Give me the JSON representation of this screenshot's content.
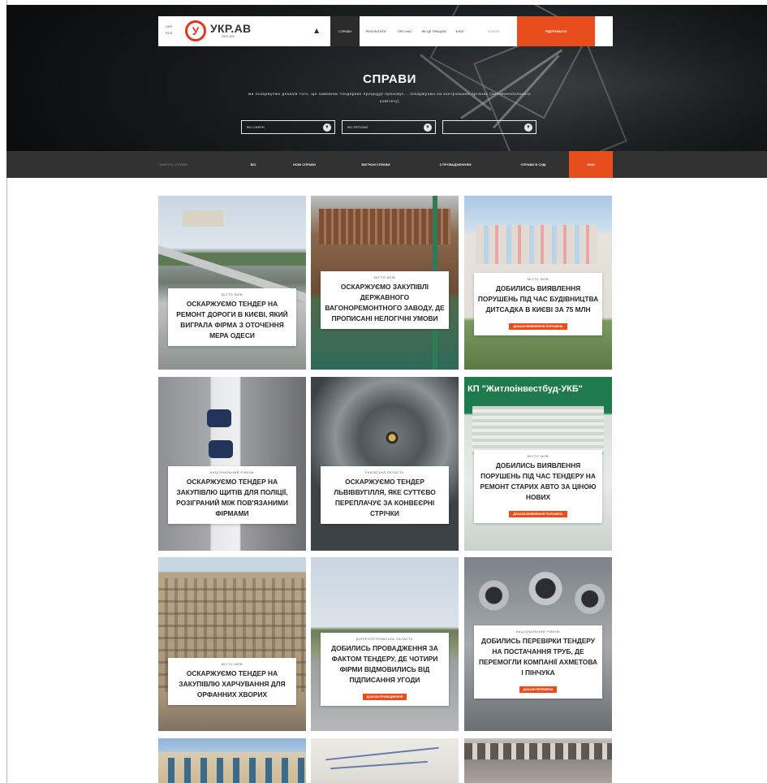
{
  "hero": {
    "title": "СПРАВИ",
    "subtitle": "ми оскаржуємо доказів того, що замовник тендерних процедур приховує... оскаржуємо на контрольних органах (антимонопольного комітету)",
    "filters": [
      {
        "label": "ВСІ СФЕРИ"
      },
      {
        "label": "ВСІ РЕГІОНИ"
      },
      {
        "label": ""
      }
    ]
  },
  "topnav": {
    "lang": [
      "UKR",
      "RUS"
    ],
    "logo_letter": "У",
    "logo_name": "УКР.АВ",
    "logo_sub": "UKR.AW",
    "menu_icon": "menu-icon",
    "items": [
      {
        "label": "СПРАВИ",
        "active": true
      },
      {
        "label": "РЕЗУЛЬТАТИ",
        "active": false
      },
      {
        "label": "ПРО НАС",
        "active": false
      },
      {
        "label": "ЯК ЦЕ ПРАЦЮЄ",
        "active": false
      },
      {
        "label": "БЛОГ",
        "active": false
      }
    ],
    "search_placeholder": "ПОШУК",
    "cta": "ПІДТРИМАТИ"
  },
  "categories": {
    "label": "ОБЕРІТЬ СПРАВИ",
    "items": [
      {
        "label": "ВСІ"
      },
      {
        "label": "НОВІ СПРАВИ"
      },
      {
        "label": "ВИГРАНІ СПРАВИ"
      },
      {
        "label": "З ПРОВАДЖЕННЯМ"
      },
      {
        "label": "СПРАВИ В СУДІ"
      },
      {
        "label": "ІНШІ"
      }
    ]
  },
  "cards": [
    {
      "region": "МІСТО КИЇВ",
      "title": "ОСКАРЖУЄМО ТЕНДЕР НА РЕМОНТ ДОРОГИ В КИЄВІ, ЯКИЙ ВИГРАЛА ФІРМА З ОТОЧЕННЯ МЕРА ОДЕСИ",
      "tag": ""
    },
    {
      "region": "МІСТО КИЇВ",
      "title": "ОСКАРЖУЄМО ЗАКУПІВЛІ ДЕРЖАВНОГО ВАГОНОРЕМОНТНОГО ЗАВОДУ, ДЕ ПРОПИСАНІ НЕЛОГІЧНІ УМОВИ",
      "tag": ""
    },
    {
      "region": "МІСТО КИЇВ",
      "title": "ДОБИЛИСЬ ВИЯВЛЕННЯ ПОРУШЕНЬ ПІД ЧАС БУДІВНИЦТВА ДИТСАДКА В КИЄВІ ЗА 75 МЛН",
      "tag": "ДОКАЗИ ВИЯВЛЕННЯ ПОРУШЕНЬ"
    },
    {
      "region": "НАЦІОНАЛЬНИЙ РІВЕНЬ",
      "title": "ОСКАРЖУЄМО ТЕНДЕР НА ЗАКУПІВЛЮ ЩИТІВ ДЛЯ ПОЛІЦІЇ, РОЗІГРАНИЙ МІЖ ПОВ'ЯЗАНИМИ ФІРМАМИ",
      "tag": ""
    },
    {
      "region": "ЛЬВІВСЬКА ОБЛАСТЬ",
      "title": "ОСКАРЖУЄМО ТЕНДЕР ЛЬВІВВУГІЛЛЯ, ЯКЕ СУТТЄВО ПЕРЕПЛАЧУЄ ЗА КОНВЕЄРНІ СТРІЧКИ",
      "tag": ""
    },
    {
      "region": "МІСТО КИЇВ",
      "title": "ДОБИЛИСЬ ВИЯВЛЕННЯ ПОРУШЕНЬ ПІД ЧАС ТЕНДЕРУ НА РЕМОНТ СТАРИХ АВТО ЗА ЦІНОЮ НОВИХ",
      "tag": "ДОКАЗИ ВИЯВЛЕННЯ ПОРУШЕНЬ"
    },
    {
      "region": "МІСТО КИЇВ",
      "title": "ОСКАРЖУЄМО ТЕНДЕР НА ЗАКУПІВЛЮ ХАРЧУВАННЯ ДЛЯ ОРФАННИХ ХВОРИХ",
      "tag": ""
    },
    {
      "region": "ДНІПРОПЕТРОВСЬКА ОБЛАСТЬ",
      "title": "ДОБИЛИСЬ ПРОВАДЖЕННЯ ЗА ФАКТОМ ТЕНДЕРУ, ДЕ ЧОТИРИ ФІРМИ ВІДМОВИЛИСЬ ВІД ПІДПИСАННЯ УГОДИ",
      "tag": "ДОКАЗИ ПРОВАДЖЕННЯ"
    },
    {
      "region": "НАЦІОНАЛЬНИЙ РІВЕНЬ",
      "title": "ДОБИЛИСЬ ПЕРЕВІРКИ ТЕНДЕРУ НА ПОСТАЧАННЯ ТРУБ, ДЕ ПЕРЕМОГЛИ КОМПАНІЇ АХМЕТОВА І ПІНЧУКА",
      "tag": "ДОКАЗИ ПЕРЕВІРКИ"
    }
  ],
  "photo_texts": {
    "sign": "КП \"Житлоінвестбуд-УКБ\""
  },
  "colors": {
    "accent": "#e84e1b",
    "dark_bar": "#323232",
    "nav_active": "#2b2b2b"
  }
}
